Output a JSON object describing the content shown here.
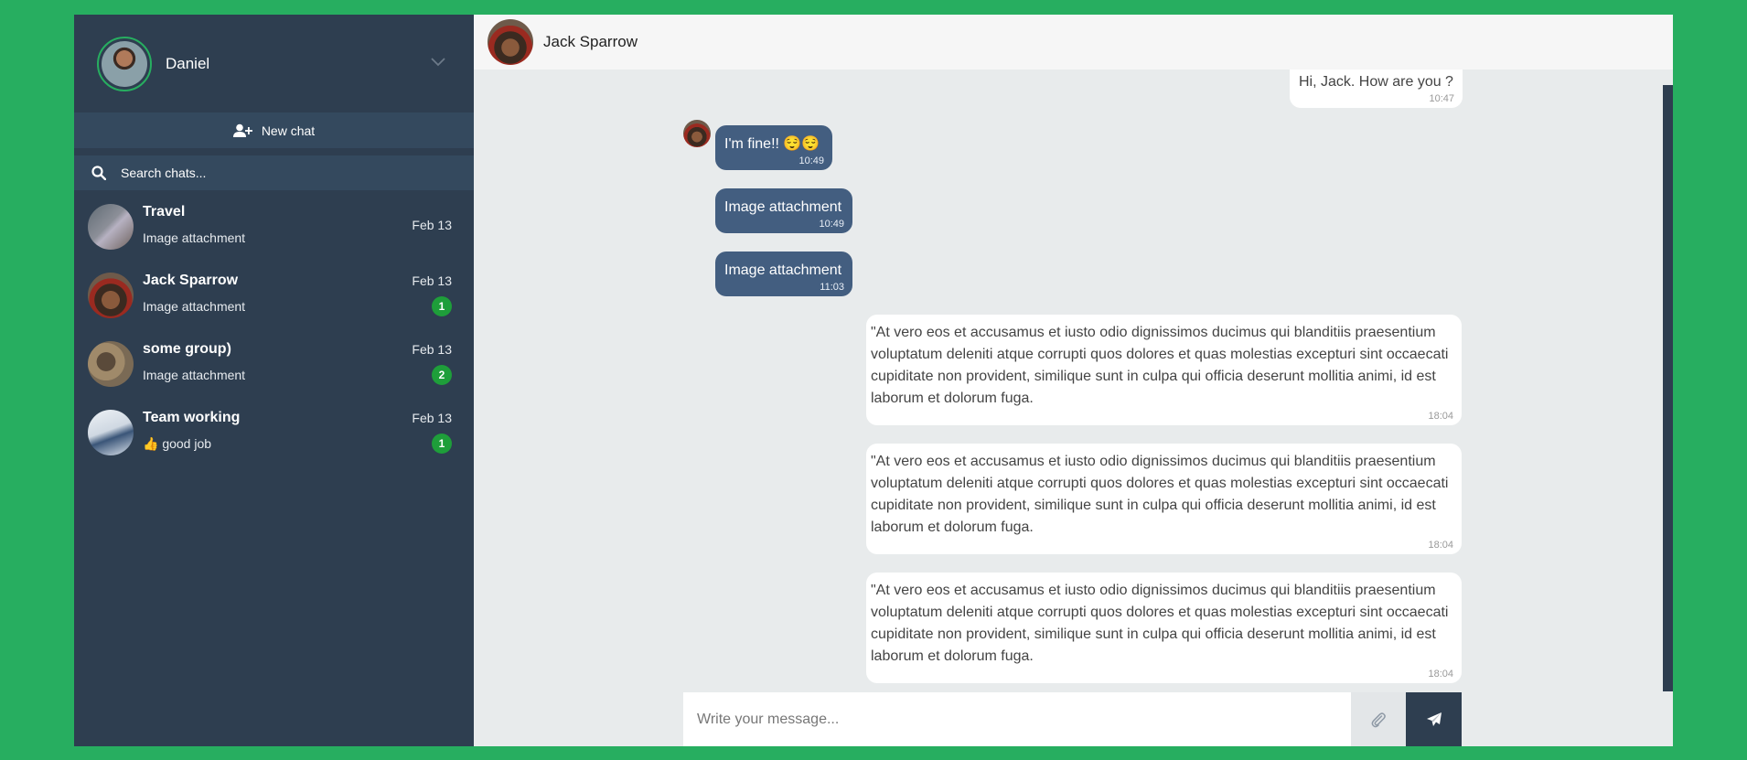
{
  "user": {
    "name": "Daniel"
  },
  "sidebar": {
    "new_chat_label": "New chat",
    "search_placeholder": "Search chats...",
    "chats": [
      {
        "name": "Travel",
        "last": "Image attachment",
        "date": "Feb 13",
        "badge": ""
      },
      {
        "name": "Jack Sparrow",
        "last": "Image attachment",
        "date": "Feb 13",
        "badge": "1"
      },
      {
        "name": "some group)",
        "last": "Image attachment",
        "date": "Feb 13",
        "badge": "2"
      },
      {
        "name": "Team working",
        "last": "👍 good job",
        "date": "Feb 13",
        "badge": "1"
      }
    ]
  },
  "conversation": {
    "contact_name": "Jack Sparrow",
    "messages": [
      {
        "dir": "out",
        "text": "Hi, Jack. How are you ?",
        "time": "10:47"
      },
      {
        "dir": "in",
        "text": "I'm fine!! 😌😌",
        "time": "10:49"
      },
      {
        "dir": "in",
        "text": "Image attachment",
        "time": "10:49"
      },
      {
        "dir": "in",
        "text": "Image attachment",
        "time": "11:03"
      },
      {
        "dir": "out",
        "text": "\"At vero eos et accusamus et iusto odio dignissimos ducimus qui blanditiis praesentium voluptatum deleniti atque corrupti quos dolores et quas molestias excepturi sint occaecati cupiditate non provident, similique sunt in culpa qui officia deserunt mollitia animi, id est laborum et dolorum fuga.",
        "time": "18:04"
      },
      {
        "dir": "out",
        "text": "\"At vero eos et accusamus et iusto odio dignissimos ducimus qui blanditiis praesentium voluptatum deleniti atque corrupti quos dolores et quas molestias excepturi sint occaecati cupiditate non provident, similique sunt in culpa qui officia deserunt mollitia animi, id est laborum et dolorum fuga.",
        "time": "18:04"
      },
      {
        "dir": "out",
        "text": "\"At vero eos et accusamus et iusto odio dignissimos ducimus qui blanditiis praesentium voluptatum deleniti atque corrupti quos dolores et quas molestias excepturi sint occaecati cupiditate non provident, similique sunt in culpa qui officia deserunt mollitia animi, id est laborum et dolorum fuga.",
        "time": "18:04"
      }
    ]
  },
  "composer": {
    "placeholder": "Write your message..."
  },
  "icons": {
    "chevron": "chevron-down-icon",
    "new_chat": "user-plus-icon",
    "search": "search-icon",
    "attach": "paperclip-icon",
    "send": "paper-plane-icon"
  },
  "colors": {
    "page_bg": "#27ae60",
    "sidebar_bg": "#2e3e50",
    "incoming_bubble": "#435e80",
    "badge": "#1e9e3a"
  }
}
